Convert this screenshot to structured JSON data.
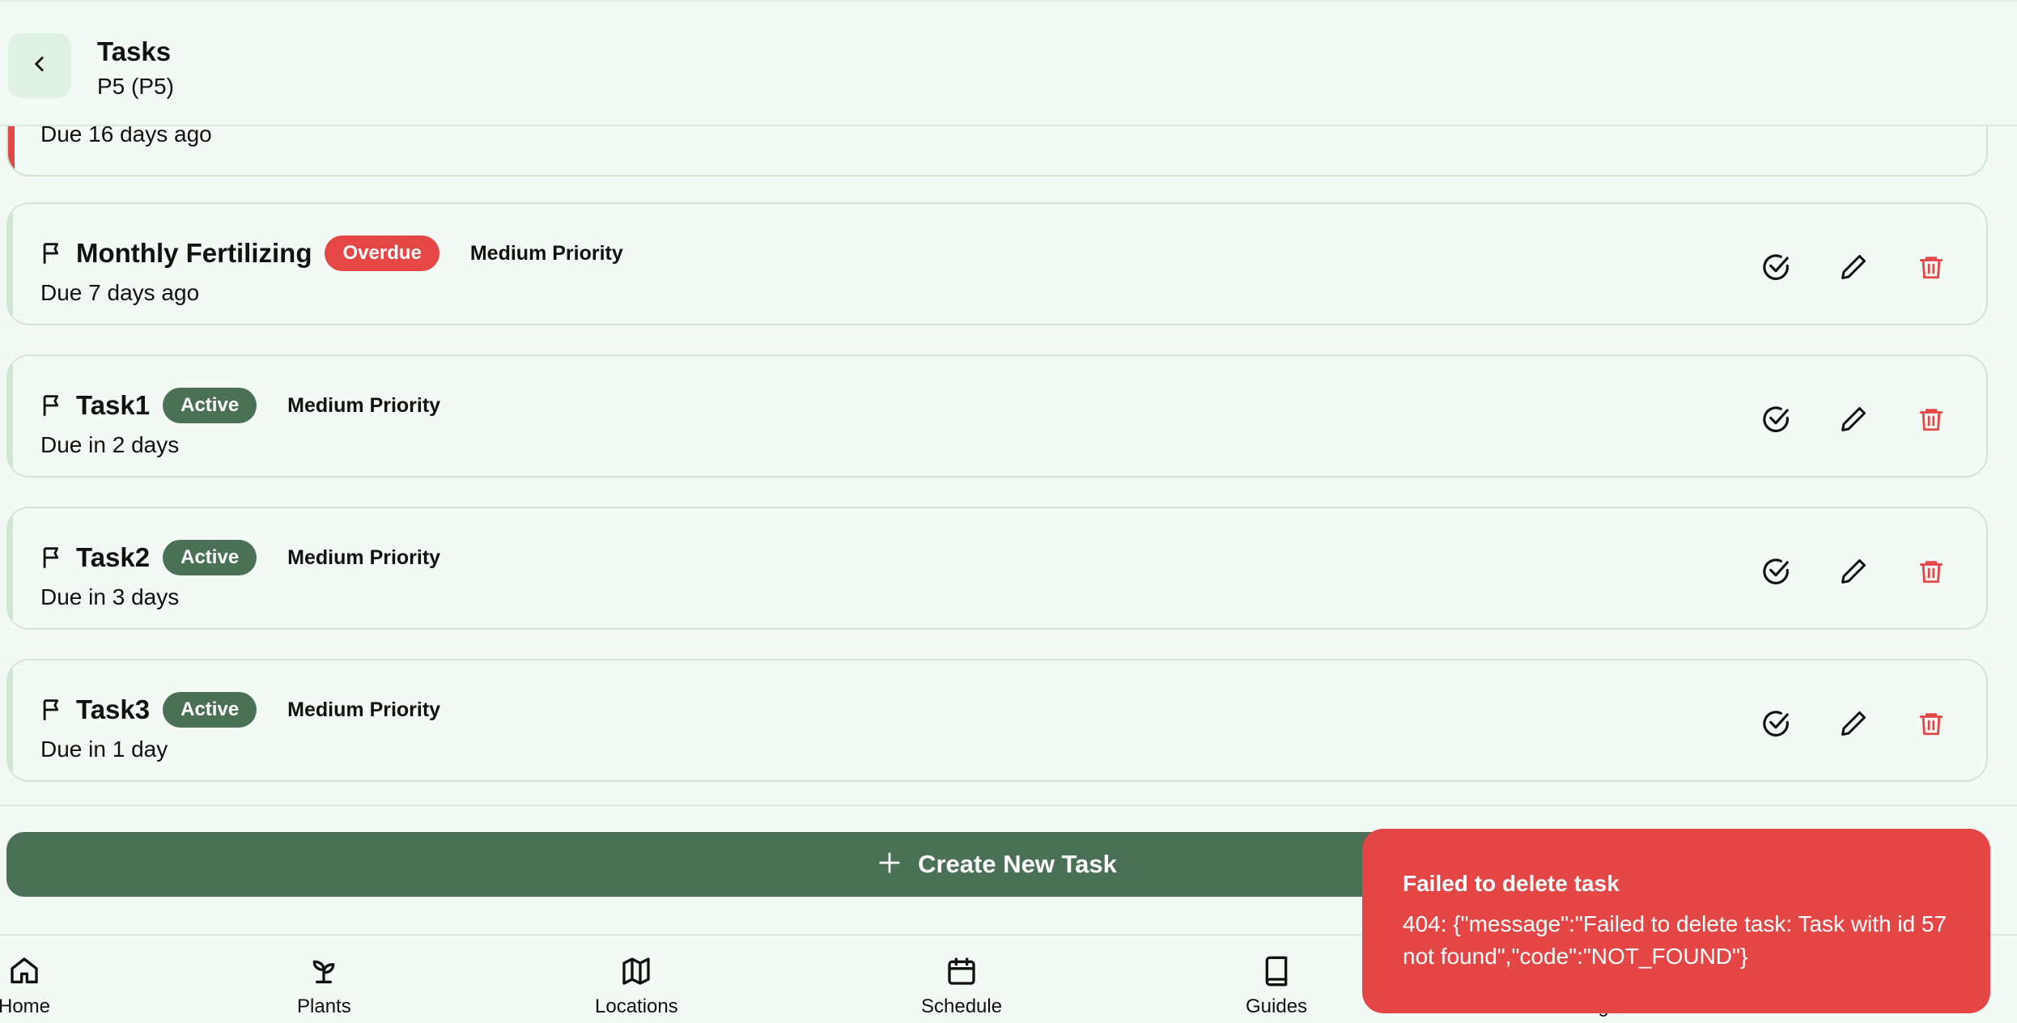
{
  "header": {
    "title": "Tasks",
    "subtitle": "P5 (P5)"
  },
  "tasks": [
    {
      "name": "",
      "status": "",
      "priority": "",
      "due": "Due 16 days ago",
      "status_color": "#e54646"
    },
    {
      "name": "Monthly Fertilizing",
      "status": "Overdue",
      "priority": "Medium Priority",
      "due": "Due 7 days ago",
      "status_color": "#e54646"
    },
    {
      "name": "Task1",
      "status": "Active",
      "priority": "Medium Priority",
      "due": "Due in 2 days",
      "status_color": "#4a7055"
    },
    {
      "name": "Task2",
      "status": "Active",
      "priority": "Medium Priority",
      "due": "Due in 3 days",
      "status_color": "#4a7055"
    },
    {
      "name": "Task3",
      "status": "Active",
      "priority": "Medium Priority",
      "due": "Due in 1 day",
      "status_color": "#4a7055"
    }
  ],
  "actions": {
    "create_label": "Create New Task"
  },
  "nav": {
    "items": [
      {
        "label": "Home",
        "icon": "home-icon"
      },
      {
        "label": "Plants",
        "icon": "sprout-icon"
      },
      {
        "label": "Locations",
        "icon": "map-icon"
      },
      {
        "label": "Schedule",
        "icon": "calendar-icon"
      },
      {
        "label": "Guides",
        "icon": "book-icon"
      },
      {
        "label": "Settings",
        "icon": "gear-icon"
      }
    ]
  },
  "toast": {
    "title": "Failed to delete task",
    "message": "404: {\"message\":\"Failed to delete task: Task with id 57 not found\",\"code\":\"NOT_FOUND\"}"
  },
  "colors": {
    "accent_green": "#4a7055",
    "error_red": "#e44646",
    "background": "#f3faf5"
  }
}
